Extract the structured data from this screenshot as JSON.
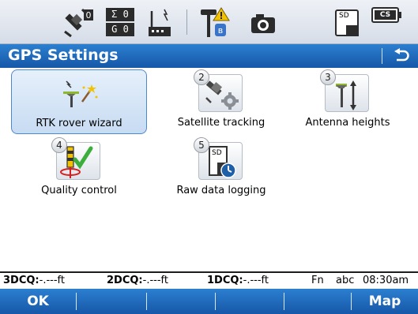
{
  "status_bar": {
    "satellite_count": "0",
    "sigma_count": "0",
    "g_count": "0",
    "sigma_label": "Σ",
    "g_label": "G",
    "sd_label": "SD",
    "cs_label": "CS"
  },
  "title_bar": {
    "title": "GPS Settings",
    "back_icon": "back-arrow-icon"
  },
  "tiles": [
    {
      "number": "",
      "label": "RTK rover wizard",
      "icon": "rtk-wizard-icon",
      "selected": true
    },
    {
      "number": "2",
      "label": "Satellite tracking",
      "icon": "satellite-gear-icon",
      "selected": false
    },
    {
      "number": "3",
      "label": "Antenna heights",
      "icon": "antenna-height-icon",
      "selected": false
    },
    {
      "number": "4",
      "label": "Quality control",
      "icon": "quality-check-icon",
      "selected": false
    },
    {
      "number": "5",
      "label": "Raw data logging",
      "icon": "sd-card-logging-icon",
      "selected": false
    }
  ],
  "info_bar": {
    "q3d_label": "3DCQ:",
    "q3d_value": "-.---ft",
    "q2d_label": "2DCQ:",
    "q2d_value": "-.---ft",
    "q1d_label": "1DCQ:",
    "q1d_value": "-.---ft",
    "fn": "Fn",
    "input_mode": "abc",
    "time": "08:30am"
  },
  "softkeys": {
    "ok": "OK",
    "map": "Map"
  },
  "colors": {
    "accent_blue": "#1e6cc0",
    "selected_tile": "#c7dbf2",
    "check_green": "#3cae3c",
    "warning_yellow": "#f2c200"
  }
}
